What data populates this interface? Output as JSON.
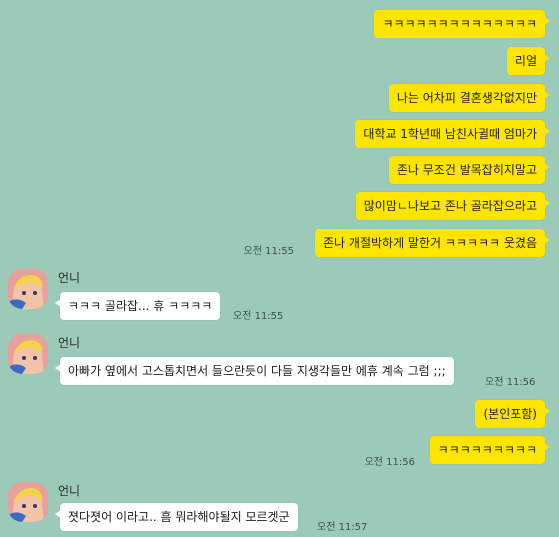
{
  "colors": {
    "background": "#9bcbb8",
    "my_bubble": "#fee500",
    "their_bubble": "#ffffff"
  },
  "sender_name": "언니",
  "messages_me_group1": [
    {
      "text": "ㅋㅋㅋㅋㅋㅋㅋㅋㅋㅋㅋㅋㅋㅋ"
    },
    {
      "text": "리얼"
    },
    {
      "text": "나는 어차피 결혼생각없지만"
    },
    {
      "text": "대학교 1학년때 남친사귈때 엄마가"
    },
    {
      "text": "존나 무조건 발목잡히지말고"
    },
    {
      "text": "많이맘ㄴ나보고 존나 골라잡으라고"
    },
    {
      "text": "존나 개절박하게 말한거 ㅋㅋㅋㅋㅋ 웃겼음",
      "time": "오전 11:55"
    }
  ],
  "messages_other_group1": [
    {
      "text": "ㅋㅋㅋ 골라잡... 휴 ㅋㅋㅋㅋ",
      "time": "오전 11:55"
    }
  ],
  "messages_other_group2": [
    {
      "text": "아빠가 옆에서 고스톱치면서 들으란듯이 다들 지생각들만 에휴 계속 그럼 ;;;",
      "time": "오전 11:56"
    }
  ],
  "messages_me_group2": [
    {
      "text": "(본인포함)"
    },
    {
      "text": "ㅋㅋㅋㅋㅋㅋㅋㅋㅋ",
      "time": "오전 11:56"
    }
  ],
  "messages_other_group3": [
    {
      "text": "졋다졋어 이라고.. 흠 뭐라해야될지 모르겟군",
      "time": "오전 11:57"
    }
  ]
}
